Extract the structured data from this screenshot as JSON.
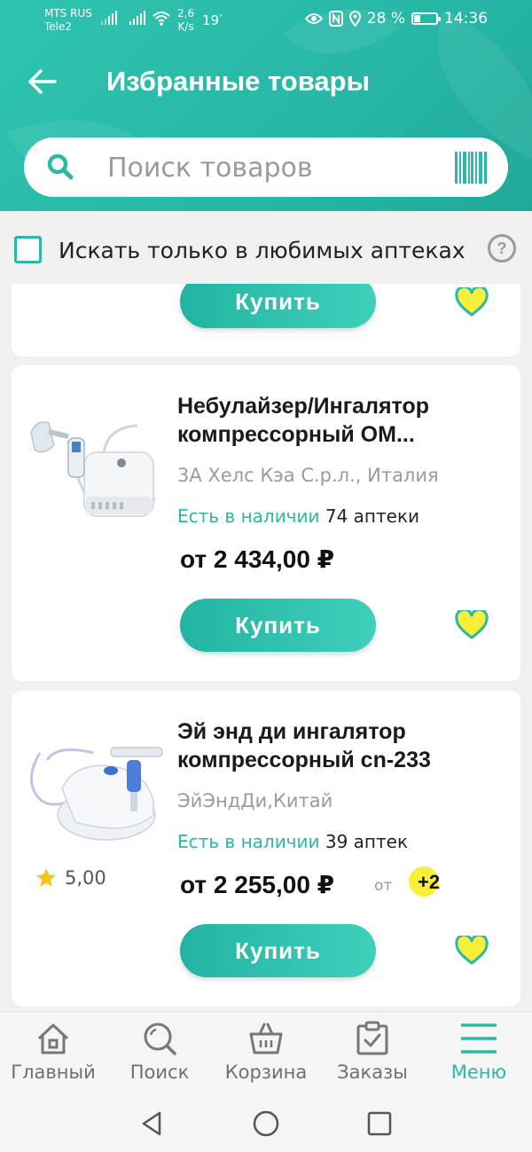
{
  "status_bar": {
    "carrier1": "MTS RUS",
    "carrier2": "Tele2",
    "speed_value": "2,6",
    "speed_unit": "K/s",
    "temperature": "19",
    "battery_percent": "28 %",
    "battery_level": 0.28,
    "time": "14:36"
  },
  "header": {
    "title": "Избранные товары",
    "search_placeholder": "Поиск товаров"
  },
  "filter": {
    "label": "Искать только в любимых аптеках",
    "checked": false,
    "help": "?"
  },
  "products": [
    {
      "buy_label": "Купить"
    },
    {
      "name": "Небулайзер/Ингалятор компрессорный ОМ...",
      "maker": "3А Хелс Кэа С.р.л., Италия",
      "availability": "Есть в наличии",
      "pharmacy_count": "74 аптеки",
      "price": "от 2 434,00 ₽",
      "buy_label": "Купить"
    },
    {
      "name": "Эй энд ди ингалятор компрессорный cn-233",
      "maker": "ЭйЭндДи,Китай",
      "availability": "Есть в наличии",
      "pharmacy_count": "39 аптек",
      "price": "от 2 255,00 ₽",
      "price_from_label": "от",
      "plus_badge": "+2",
      "rating": "5,00",
      "buy_label": "Купить"
    }
  ],
  "bottom_nav": {
    "items": [
      {
        "label": "Главный",
        "icon": "home-icon"
      },
      {
        "label": "Поиск",
        "icon": "search-icon"
      },
      {
        "label": "Корзина",
        "icon": "basket-icon"
      },
      {
        "label": "Заказы",
        "icon": "orders-clipboard-icon"
      },
      {
        "label": "Меню",
        "icon": "menu-hamburger-icon",
        "active": true
      }
    ]
  },
  "colors": {
    "primary": "#2bb8a6",
    "heart": "#f9ee38",
    "star": "#f5c518"
  }
}
